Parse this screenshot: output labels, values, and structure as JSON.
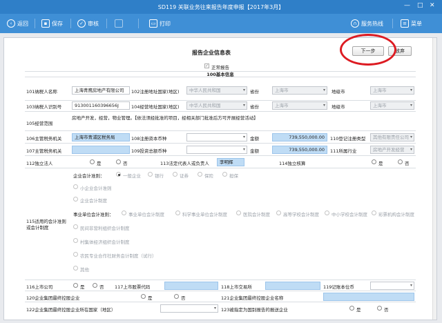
{
  "window": {
    "title": "SD119 关联业务往来报告年度申报【2017年3月】",
    "min": "—",
    "max": "□",
    "close": "✕"
  },
  "toolbar": {
    "back": "返回",
    "save": "保存",
    "audit": "审核",
    "blank": "",
    "print": "打印",
    "hotline": "服务热线",
    "menu": "菜单"
  },
  "form": {
    "title": "报告企业信息表",
    "next": "下一步",
    "cancel": "放弃",
    "normal_report": "正常报告",
    "section": "100基本信息"
  },
  "rows": {
    "r101": {
      "label": "101纳税人名称",
      "value": "上海青鹰房地产有限公司",
      "reg_label": "102注册地址国家(地区)",
      "reg_value": "中华人民共和国",
      "prov_label": "省份",
      "prov_value": "上海市",
      "city_label": "地级市",
      "city_value": "上海市"
    },
    "r103": {
      "label": "103纳税人识别号",
      "value": "913001160396656J",
      "biz_label": "104经营地址国家(地区)",
      "biz_value": "中华人民共和国",
      "prov_label": "省份",
      "prov_value": "上海市",
      "city_label": "地级市",
      "city_value": "上海市"
    },
    "r105": {
      "label": "105经营范围",
      "value": "房地产开发，经营，物业管理。【依法须经批准的项目，经相关部门批准后方可开展经营活动】"
    },
    "r106": {
      "label": "106主管税务机关",
      "value": "上海市青浦区税务局",
      "cur_label": "108注册资本币种",
      "cur_value": "",
      "amt_label": "金额",
      "amt_value": "739,550,000.00",
      "type_label": "110登记注册类型",
      "type_value": "其他有限责任公司"
    },
    "r107": {
      "label": "107主管税务机关",
      "value": "",
      "cur_label": "109投资总额币种",
      "cur_value": "",
      "amt_label": "金额",
      "amt_value": "739,550,000.00",
      "ind_label": "111所属行业",
      "ind_value": "房地产开发经营"
    },
    "r112": {
      "label": "112独立法人",
      "yes": "是",
      "no": "否",
      "rep_label": "113法定代表人或负责人",
      "rep_value": "李明辉",
      "dep_label": "114独立核算",
      "dep_yes": "是",
      "dep_no": "否"
    },
    "r115": {
      "label": "115适用的会计准则或会计制度",
      "corp_label": "企业会计准则：",
      "corp_options": [
        "一般企业",
        "银行",
        "证券",
        "保险",
        "担保"
      ],
      "small_std": "小企业会计准则",
      "corp_system": "企业会计制度",
      "inst_label": "事业单位会计准则：",
      "inst_options": [
        "事业单位会计制度",
        "科学事业单位会计制度",
        "医院会计制度",
        "高等学校会计制度",
        "中小学校会计制度",
        "彩票机构会计制度"
      ],
      "npo": "民间非营利组织会计制度",
      "village": "村集体经济组织会计制度",
      "coop": "农民专业合作社财务会计制度（试行）",
      "other": "其他"
    },
    "r116": {
      "label": "116上市公司",
      "yes": "是",
      "no": "否",
      "code_label": "117上市股票代码",
      "exch_label": "118上市交易所",
      "cur_label": "119记账本位币"
    },
    "r120": {
      "label": "120企业集团最终控股企业",
      "yes": "是",
      "no": "否",
      "name_label": "121企业集团最终控股企业名称"
    },
    "r122": {
      "label": "122企业集团最终控股企业所在国家（地区）",
      "flag_label": "123被指定为国别报告的报送企业",
      "yes": "是",
      "no": "否"
    }
  }
}
